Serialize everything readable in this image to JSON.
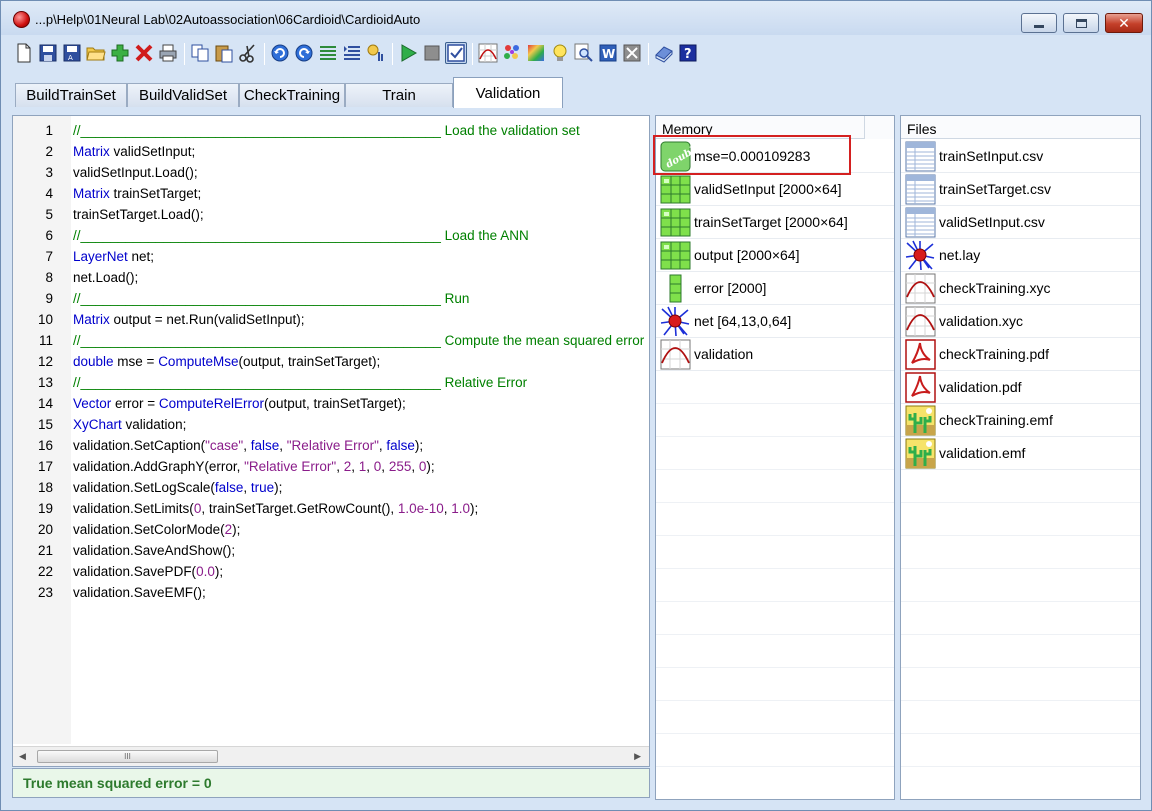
{
  "window": {
    "title": "...p\\Help\\01Neural Lab\\02Autoassociation\\06Cardioid\\CardioidAuto",
    "close_glyph": "✕"
  },
  "toolbar": {
    "buttons": [
      "new-file",
      "save",
      "save-as",
      "open-folder",
      "add",
      "delete",
      "print",
      "copy",
      "paste",
      "cut",
      "undo",
      "redo",
      "align-left",
      "align-right",
      "wizard",
      "run",
      "stop",
      "check-mode",
      "chart",
      "palette",
      "colors",
      "idea",
      "find",
      "word",
      "excel",
      "book",
      "help"
    ],
    "word_label": "W",
    "help_label": "?"
  },
  "tabs": [
    "BuildTrainSet",
    "BuildValidSet",
    "CheckTraining",
    "Train",
    "Validation"
  ],
  "active_tab": "Validation",
  "editor": {
    "line_numbers": [
      "1",
      "2",
      "3",
      "4",
      "5",
      "6",
      "7",
      "8",
      "9",
      "10",
      "11",
      "12",
      "13",
      "14",
      "15",
      "16",
      "17",
      "18",
      "19",
      "20",
      "21",
      "22",
      "23"
    ],
    "lines": [
      {
        "p": [
          {
            "t": "//________________________________________________  Load the validation set",
            "c": "cm"
          }
        ]
      },
      {
        "p": [
          {
            "t": "Matrix",
            "c": "kw"
          },
          {
            "t": " validSetInput;"
          }
        ]
      },
      {
        "p": [
          {
            "t": "validSetInput.Load();"
          }
        ]
      },
      {
        "p": [
          {
            "t": "Matrix",
            "c": "kw"
          },
          {
            "t": " trainSetTarget;"
          }
        ]
      },
      {
        "p": [
          {
            "t": "trainSetTarget.Load();"
          }
        ]
      },
      {
        "p": [
          {
            "t": "//________________________________________________ Load the ANN",
            "c": "cm"
          }
        ]
      },
      {
        "p": [
          {
            "t": "LayerNet",
            "c": "kw"
          },
          {
            "t": " net;"
          }
        ]
      },
      {
        "p": [
          {
            "t": "net.Load();"
          }
        ]
      },
      {
        "p": [
          {
            "t": "//________________________________________________ Run",
            "c": "cm"
          }
        ]
      },
      {
        "p": [
          {
            "t": "Matrix",
            "c": "kw"
          },
          {
            "t": " output = net.Run(validSetInput);"
          }
        ]
      },
      {
        "p": [
          {
            "t": "//________________________________________________ Compute the mean squared error",
            "c": "cm"
          }
        ]
      },
      {
        "p": [
          {
            "t": "double",
            "c": "kw"
          },
          {
            "t": " mse = "
          },
          {
            "t": "ComputeMse",
            "c": "kw"
          },
          {
            "t": "(output, trainSetTarget);"
          }
        ]
      },
      {
        "p": [
          {
            "t": "//________________________________________________ Relative Error",
            "c": "cm"
          }
        ]
      },
      {
        "p": [
          {
            "t": "Vector",
            "c": "kw"
          },
          {
            "t": " error = "
          },
          {
            "t": "ComputeRelError",
            "c": "kw"
          },
          {
            "t": "(output, trainSetTarget);"
          }
        ]
      },
      {
        "p": [
          {
            "t": "XyChart",
            "c": "kw"
          },
          {
            "t": " validation;"
          }
        ]
      },
      {
        "p": [
          {
            "t": "validation.SetCaption("
          },
          {
            "t": "\"case\"",
            "c": "str"
          },
          {
            "t": ", "
          },
          {
            "t": "false",
            "c": "kw"
          },
          {
            "t": ", "
          },
          {
            "t": "\"Relative Error\"",
            "c": "str"
          },
          {
            "t": ", "
          },
          {
            "t": "false",
            "c": "kw"
          },
          {
            "t": ");"
          }
        ]
      },
      {
        "p": [
          {
            "t": "validation.AddGraphY(error, "
          },
          {
            "t": "\"Relative Error\"",
            "c": "str"
          },
          {
            "t": ", "
          },
          {
            "t": "2",
            "c": "num"
          },
          {
            "t": ", "
          },
          {
            "t": "1",
            "c": "num"
          },
          {
            "t": ", "
          },
          {
            "t": "0",
            "c": "num"
          },
          {
            "t": ", "
          },
          {
            "t": "255",
            "c": "num"
          },
          {
            "t": ", "
          },
          {
            "t": "0",
            "c": "num"
          },
          {
            "t": ");"
          }
        ]
      },
      {
        "p": [
          {
            "t": "validation.SetLogScale("
          },
          {
            "t": "false",
            "c": "kw"
          },
          {
            "t": ", "
          },
          {
            "t": "true",
            "c": "kw"
          },
          {
            "t": ");"
          }
        ]
      },
      {
        "p": [
          {
            "t": "validation.SetLimits("
          },
          {
            "t": "0",
            "c": "num"
          },
          {
            "t": ", trainSetTarget.GetRowCount(), "
          },
          {
            "t": "1.0e-10",
            "c": "num"
          },
          {
            "t": ", "
          },
          {
            "t": "1.0",
            "c": "num"
          },
          {
            "t": ");"
          }
        ]
      },
      {
        "p": [
          {
            "t": "validation.SetColorMode("
          },
          {
            "t": "2",
            "c": "num"
          },
          {
            "t": ");"
          }
        ]
      },
      {
        "p": [
          {
            "t": "validation.SaveAndShow();"
          }
        ]
      },
      {
        "p": [
          {
            "t": "validation.SavePDF("
          },
          {
            "t": "0.0",
            "c": "num"
          },
          {
            "t": ");"
          }
        ]
      },
      {
        "p": [
          {
            "t": "validation.SaveEMF();"
          }
        ]
      }
    ],
    "scroll_thumb_grip": "III",
    "scroll_left": "◀",
    "scroll_right": "▶"
  },
  "status": {
    "text": "True mean squared error = 0"
  },
  "memory": {
    "header": "Memory",
    "items": [
      {
        "label": "mse=0.000109283",
        "icon": "double-icon"
      },
      {
        "label": "validSetInput [2000×64]",
        "icon": "matrix-icon"
      },
      {
        "label": "trainSetTarget [2000×64]",
        "icon": "matrix-icon"
      },
      {
        "label": "output [2000×64]",
        "icon": "matrix-icon"
      },
      {
        "label": "error [2000]",
        "icon": "vector-icon"
      },
      {
        "label": "net [64,13,0,64]",
        "icon": "neural-net-icon"
      },
      {
        "label": "validation",
        "icon": "xychart-icon"
      }
    ],
    "double_icon_text": "double"
  },
  "files": {
    "header": "Files",
    "items": [
      {
        "label": "trainSetInput.csv",
        "icon": "csv-file-icon"
      },
      {
        "label": "trainSetTarget.csv",
        "icon": "csv-file-icon"
      },
      {
        "label": "validSetInput.csv",
        "icon": "csv-file-icon"
      },
      {
        "label": "net.lay",
        "icon": "neural-net-icon"
      },
      {
        "label": "checkTraining.xyc",
        "icon": "xychart-icon"
      },
      {
        "label": "validation.xyc",
        "icon": "xychart-icon"
      },
      {
        "label": "checkTraining.pdf",
        "icon": "pdf-file-icon"
      },
      {
        "label": "validation.pdf",
        "icon": "pdf-file-icon"
      },
      {
        "label": "checkTraining.emf",
        "icon": "emf-file-icon"
      },
      {
        "label": "validation.emf",
        "icon": "emf-file-icon"
      }
    ]
  }
}
